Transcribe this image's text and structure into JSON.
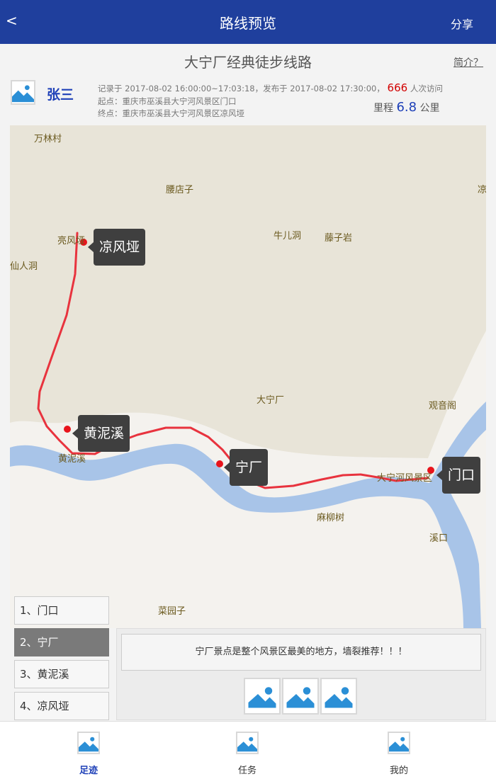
{
  "header": {
    "back_label": "<",
    "title": "路线预览",
    "share_label": "分享"
  },
  "route": {
    "title": "大宁厂经典徒步线路",
    "intro_link": "简介？",
    "author": "张三",
    "record_prefix": "记录于 ",
    "record_time": "2017-08-02 16:00:00~17:03:18",
    "publish_prefix": "，发布于 ",
    "publish_time": "2017-08-02 17:30:00",
    "visits_sep": "，",
    "visits": "666",
    "visits_suffix": " 人次访问",
    "start_label": "起点：",
    "start_place": "重庆市巫溪县大宁河风景区门口",
    "end_label": "终点：",
    "end_place": "重庆市巫溪县大宁河风景区凉风垭",
    "distance_label": "里程 ",
    "distance_value": "6.8",
    "distance_unit": " 公里"
  },
  "map": {
    "place_labels": {
      "wanlincun": "万林村",
      "yaodianzi": "腰店子",
      "liang_edge": "凉",
      "liangfengya_map": "亮风垭",
      "niuerdong": "牛儿洞",
      "tengziyan": "藤子岩",
      "xianrendong": "仙人洞",
      "daningchang": "大宁厂",
      "guanyinge": "观音阁",
      "huangnixi_map": "黄泥溪",
      "daninghe": "大宁河风景区",
      "maliushu": "麻柳树",
      "xikou": "溪口",
      "caiyuanzi": "菜园子"
    },
    "callouts": {
      "liangfengya": "凉风垭",
      "huangnixi": "黄泥溪",
      "ningchang": "宁厂",
      "menkou": "门口"
    },
    "colors": {
      "route": "#e8333e",
      "river": "#a8c4e8",
      "road": "#f5e1a6",
      "land": "#e8e4d8"
    }
  },
  "stops": [
    {
      "label": "1、门口",
      "active": false
    },
    {
      "label": "2、宁厂",
      "active": true
    },
    {
      "label": "3、黄泥溪",
      "active": false
    },
    {
      "label": "4、凉风垭",
      "active": false
    }
  ],
  "detail": {
    "description": "宁厂景点是整个风景区最美的地方，墙裂推荐！！！"
  },
  "bottom_nav": [
    {
      "label": "足迹",
      "icon": "image-placeholder-icon",
      "active": true
    },
    {
      "label": "任务",
      "icon": "image-placeholder-icon",
      "active": false
    },
    {
      "label": "我的",
      "icon": "image-placeholder-icon",
      "active": false
    }
  ]
}
